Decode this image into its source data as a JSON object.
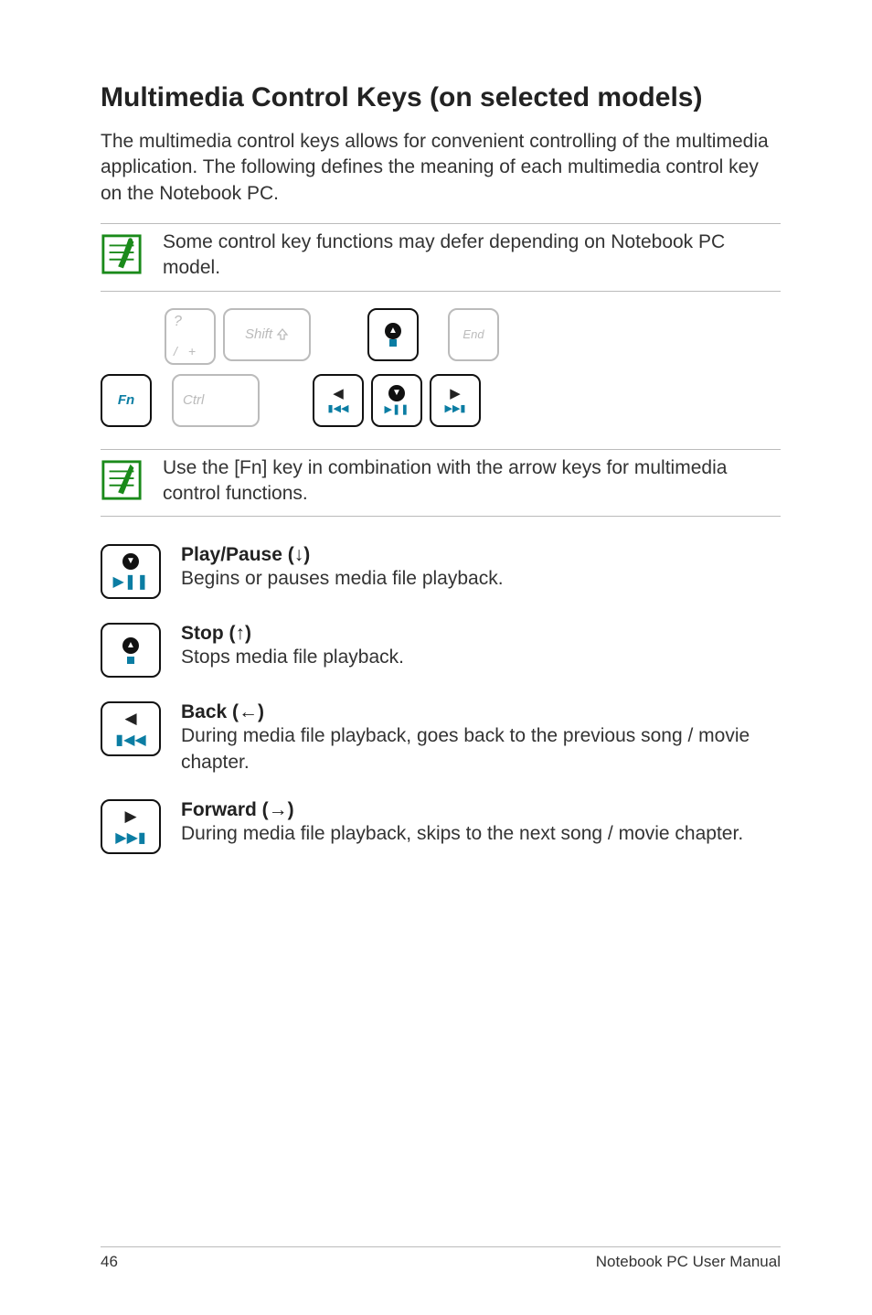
{
  "title": "Multimedia Control Keys (on selected models)",
  "intro": "The multimedia control keys allows for convenient controlling of the multimedia application. The following defines the meaning of each multimedia control key on the Notebook PC.",
  "note1": "Some control key functions may defer depending on Notebook PC model.",
  "note2": "Use the [Fn] key in combination with the arrow keys for multimedia control functions.",
  "keys": {
    "fn": "Fn",
    "shift_label": "Shift",
    "ctrl": "Ctrl",
    "end": "End",
    "qmark_top": "?",
    "qmark_slash": "/",
    "qmark_plus": "+"
  },
  "functions": [
    {
      "title": "Play/Pause (↓)",
      "desc": "Begins or pauses media file playback.",
      "icon": "play-pause"
    },
    {
      "title": "Stop (↑)",
      "desc": "Stops media file playback.",
      "icon": "stop"
    },
    {
      "title": "Back (←)",
      "desc": "During media file playback, goes back to the previous song / movie chapter.",
      "icon": "back"
    },
    {
      "title": "Forward (→)",
      "desc": "During media file playback, skips to the next song / movie chapter.",
      "icon": "forward"
    }
  ],
  "footer": {
    "page": "46",
    "doc": "Notebook PC User Manual"
  }
}
